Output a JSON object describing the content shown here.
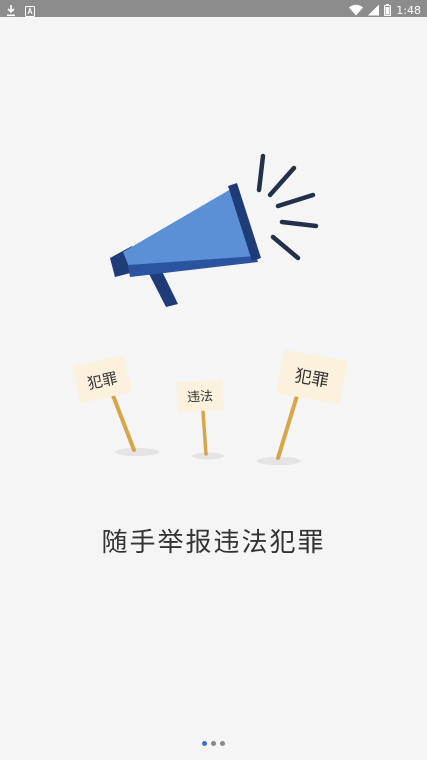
{
  "status_bar": {
    "time": "1:48",
    "left_icons": [
      "download-icon",
      "accessibility-icon"
    ],
    "right_icons": [
      "wifi-icon",
      "signal-icon",
      "battery-icon"
    ]
  },
  "illustration": {
    "icons": [
      "megaphone-icon"
    ],
    "signs": [
      "犯罪",
      "违法",
      "犯罪"
    ]
  },
  "headline": "随手举报违法犯罪",
  "pager": {
    "page_count": 3,
    "active_index": 0
  },
  "colors": {
    "status_bar_bg": "#8c8c8c",
    "page_bg": "#f5f5f5",
    "megaphone_blue": "#5b8fd6",
    "megaphone_dark": "#1f3c78",
    "sign_board": "#fbf1dc",
    "sign_stick": "#d8a64a",
    "active_dot": "#3a6fd1",
    "inactive_dot": "#8a8a8a"
  }
}
